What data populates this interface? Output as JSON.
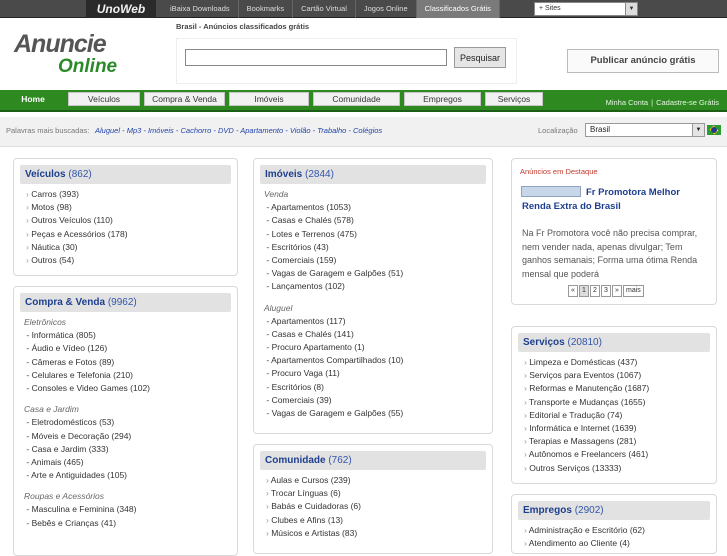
{
  "topbar": {
    "logo": "UnoWeb",
    "nav": [
      "iBaixa Downloads",
      "Bookmarks",
      "Cartão Virtual",
      "Jogos Online",
      "Classificados Grátis"
    ],
    "sites_select": "+ Sites"
  },
  "brand": {
    "line1": "Anuncie",
    "line2": "Online"
  },
  "breadcrumb": "Brasil - Anúncios classificados grátis",
  "search": {
    "value": "",
    "button": "Pesquisar"
  },
  "publish_button": "Publicar anúncio grátis",
  "tabs": [
    "Home",
    "Veículos",
    "Compra & Venda",
    "Imóveis",
    "Comunidade",
    "Empregos",
    "Serviços"
  ],
  "account": {
    "my_account": "Minha Conta",
    "separator": "|",
    "register": "Cadastre-se Grátis"
  },
  "recent_searches": {
    "label": "Palavras mais buscadas:",
    "keywords": [
      "Aluguel",
      "Mp3",
      "Imóveis",
      "Cachorro",
      "DVD",
      "Apartamento",
      "Violão",
      "Trabalho",
      "Colégios"
    ]
  },
  "location": {
    "label": "Localização",
    "value": "Brasil"
  },
  "veiculos": {
    "title": "Veículos",
    "count": "(862)",
    "items": [
      "Carros (393)",
      "Motos (98)",
      "Outros Veículos (110)",
      "Peças e Acessórios (178)",
      "Náutica (30)",
      "Outros (54)"
    ]
  },
  "compra_venda": {
    "title": "Compra & Venda",
    "count": "(9962)",
    "groups": [
      {
        "name": "Eletrônicos",
        "items": [
          "Informática (805)",
          "Áudio e Vídeo (126)",
          "Câmeras e Fotos (89)",
          "Celulares e Telefonia (210)",
          "Consoles e Video Games (102)"
        ]
      },
      {
        "name": "Casa e Jardim",
        "items": [
          "Eletrodomésticos (53)",
          "Móveis e Decoração (294)",
          "Casa e Jardim (333)",
          "Animais (465)",
          "Arte e Antiguidades (105)"
        ]
      },
      {
        "name": "Roupas e Acessórios",
        "items": [
          "Masculina e Feminina (348)",
          "Bebês e Crianças (41)"
        ]
      }
    ]
  },
  "imoveis": {
    "title": "Imóveis",
    "count": "(2844)",
    "groups": [
      {
        "name": "Venda",
        "items": [
          "Apartamentos (1053)",
          "Casas e Chalés (578)",
          "Lotes e Terrenos (475)",
          "Escritórios (43)",
          "Comerciais (159)",
          "Vagas de Garagem e Galpões (51)",
          "Lançamentos (102)"
        ]
      },
      {
        "name": "Aluguel",
        "items": [
          "Apartamentos (117)",
          "Casas e Chalés (141)",
          "Procuro Apartamento (1)",
          "Apartamentos Compartilhados (10)",
          "Procuro Vaga (11)",
          "Escritórios (8)",
          "Comerciais (39)",
          "Vagas de Garagem e Galpões (55)"
        ]
      }
    ]
  },
  "comunidade": {
    "title": "Comunidade",
    "count": "(762)",
    "items": [
      "Aulas e Cursos (239)",
      "Trocar Línguas (6)",
      "Babás e Cuidadoras (6)",
      "Clubes e Afins (13)",
      "Músicos e Artistas (83)"
    ]
  },
  "featured": {
    "label": "Anúncios em Destaque",
    "title": "Fr Promotora Melhor Renda Extra do Brasil",
    "body": "Na Fr Promotora você não precisa comprar, nem vender nada, apenas divulgar; Tem ganhos semanais; Forma uma ótima Renda mensal que poderá",
    "pager": [
      "«",
      "1",
      "2",
      "3",
      "»",
      "mais"
    ]
  },
  "servicos": {
    "title": "Serviços",
    "count": "(20810)",
    "items": [
      "Limpeza e Domésticas (437)",
      "Serviços para Eventos (1067)",
      "Reformas e Manutenção (1687)",
      "Transporte e Mudanças (1655)",
      "Editorial e Tradução (74)",
      "Informática e Internet (1639)",
      "Terapias e Massagens (281)",
      "Autônomos e Freelancers (461)",
      "Outros Serviços (13333)"
    ]
  },
  "empregos": {
    "title": "Empregos",
    "count": "(2902)",
    "items": [
      "Administração e Escritório (62)",
      "Atendimento ao Cliente (4)"
    ]
  },
  "colors": {
    "nav_green": "#2e8a20",
    "link_blue": "#1e3f8f",
    "featured_red": "#c0392b"
  }
}
